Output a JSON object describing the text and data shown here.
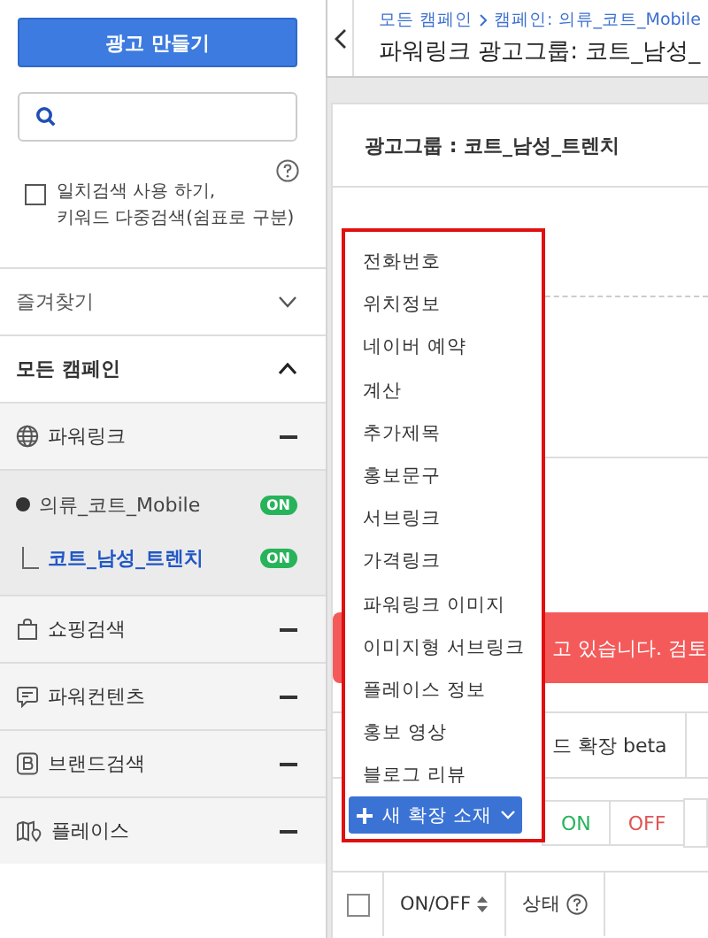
{
  "sidebar": {
    "create_button": "광고 만들기",
    "exact_match": {
      "checked": false,
      "lines": [
        "일치검색 사용 하기,",
        "키워드 다중검색(쉼표로 구분)"
      ]
    },
    "favorites": {
      "label": "즐겨찾기",
      "expanded": false
    },
    "all_campaigns": {
      "label": "모든 캠페인",
      "expanded": true
    },
    "campaign_types": [
      {
        "kind": "powerlink",
        "label": "파워링크",
        "children": [
          {
            "label": "의류_코트_Mobile",
            "status": "ON",
            "selected": false,
            "children": [
              {
                "label": "코트_남성_트렌치",
                "status": "ON",
                "selected": true
              }
            ]
          }
        ]
      },
      {
        "kind": "shopping",
        "label": "쇼핑검색"
      },
      {
        "kind": "content",
        "label": "파워컨텐츠"
      },
      {
        "kind": "brand",
        "label": "브랜드검색"
      },
      {
        "kind": "place",
        "label": "플레이스"
      }
    ]
  },
  "header": {
    "breadcrumb": [
      "모든 캠페인",
      "캠페인: 의류_코트_Mobile"
    ],
    "title": "파워링크 광고그룹:  코트_남성_"
  },
  "card": {
    "title": "광고그룹 : 코트_남성_트렌치",
    "banner_text": "고 있습니다. 검토",
    "tab": "드 확장 beta",
    "dropdown": {
      "items": [
        "전화번호",
        "위치정보",
        "네이버 예약",
        "계산",
        "추가제목",
        "홍보문구",
        "서브링크",
        "가격링크",
        "파워링크 이미지",
        "이미지형 서브링크",
        "플레이스 정보",
        "홍보 영상",
        "블로그 리뷰"
      ],
      "button": "새 확장 소재"
    },
    "toolbar": [
      {
        "kind": "on",
        "label": "ON"
      },
      {
        "kind": "off",
        "label": "OFF"
      }
    ],
    "select_all": {
      "checked": false
    },
    "columns": [
      {
        "label": "ON/OFF",
        "kind": "sort"
      },
      {
        "label": "상태",
        "kind": "help"
      }
    ]
  }
}
